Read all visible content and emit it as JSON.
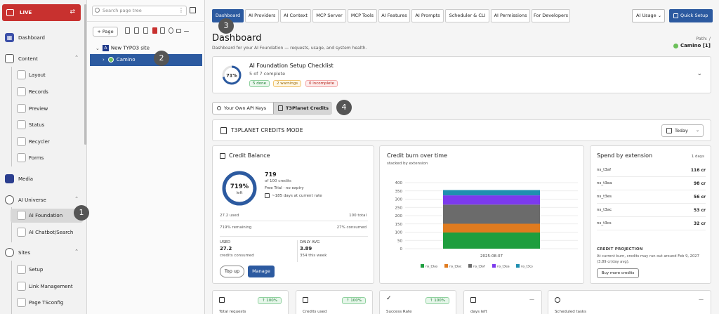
{
  "live": {
    "label": "LIVE"
  },
  "menu": {
    "dashboard": "Dashboard",
    "content": "Content",
    "layout": "Layout",
    "records": "Records",
    "preview": "Preview",
    "status": "Status",
    "recycler": "Recycler",
    "forms": "Forms",
    "media": "Media",
    "ai_universe": "AI Universe",
    "ai_foundation": "AI Foundation",
    "ai_chatbot": "AI Chatbot/Search",
    "sites": "Sites",
    "setup": "Setup",
    "link_management": "Link Management",
    "page_tsconfig": "Page TSconfig"
  },
  "tree": {
    "search_placeholder": "Search page tree",
    "new_page": "+ Page",
    "root": "New TYPO3 site",
    "root_logo": "A",
    "node": "Camino"
  },
  "tabs": [
    "Dashboard",
    "AI Providers",
    "AI Context",
    "MCP Server",
    "MCP Tools",
    "AI Features",
    "AI Prompts",
    "Scheduler & CLI",
    "AI Permissions",
    "For Developers"
  ],
  "header": {
    "ai_usage": "AI Usage",
    "quick_setup": "Quick Setup",
    "title": "Dashboard",
    "subtitle": "Dashboard for your AI Foundation — requests, usage, and system health.",
    "path_label": "Path: /",
    "path_value": "Camino [1]"
  },
  "checklist": {
    "percent": "71%",
    "progress": 0.71,
    "title": "AI Foundation Setup Checklist",
    "subtitle": "5 of 7 complete",
    "done": "5 done",
    "warnings": "2 warnings",
    "incomplete": "0 incomplete"
  },
  "mode_toggle": {
    "own": "Your Own API Keys",
    "t3": "T3Planet Credits"
  },
  "credits_mode": {
    "title": "T3PLANET CREDITS MODE",
    "range": "Today"
  },
  "balance": {
    "title": "Credit Balance",
    "ring_value": "719%",
    "ring_label": "left",
    "ring_fill": 1.0,
    "value": "719",
    "of": "of 100 credits",
    "plan": "Free Trial · no expiry",
    "days": "~185 days at current rate",
    "used_line": "27.2 used",
    "total_line": "100 total",
    "remaining_line": "719% remaining",
    "consumed_line": "27% consumed",
    "used_label": "USED",
    "used_value": "27.2",
    "used_sub": "credits consumed",
    "avg_label": "DAILY AVG",
    "avg_value": "3.89",
    "avg_sub": "354 this week",
    "top_up": "Top up",
    "manage": "Manage"
  },
  "burn": {
    "title": "Credit burn over time",
    "subtitle": "stacked by extension"
  },
  "chart_data": {
    "type": "bar",
    "stacked": true,
    "categories": [
      "2025-08-07"
    ],
    "series": [
      {
        "name": "ns_t3as",
        "values": [
          98
        ],
        "color": "#1e9e3e"
      },
      {
        "name": "ns_t3ac",
        "values": [
          53
        ],
        "color": "#e07b1f"
      },
      {
        "name": "ns_t3af",
        "values": [
          116
        ],
        "color": "#6b6b6b"
      },
      {
        "name": "ns_t3ea",
        "values": [
          56
        ],
        "color": "#7c3aed"
      },
      {
        "name": "ns_t3cs",
        "values": [
          32
        ],
        "color": "#1f8fb0"
      }
    ],
    "ylim": [
      0,
      400
    ],
    "yticks": [
      "0",
      "50",
      "100",
      "150",
      "200",
      "250",
      "300",
      "350",
      "400"
    ],
    "grid": true,
    "legend": "bottom"
  },
  "spend": {
    "title": "Spend by extension",
    "range": "1 days",
    "rows": [
      {
        "name": "ns_t3af",
        "value": "116 cr"
      },
      {
        "name": "ns_t3ea",
        "value": "98 cr"
      },
      {
        "name": "ns_t3es",
        "value": "56 cr"
      },
      {
        "name": "ns_t3ac",
        "value": "53 cr"
      },
      {
        "name": "ns_t3cs",
        "value": "32 cr"
      }
    ],
    "projection_label": "CREDIT PROJECTION",
    "projection_text": "At current burn, credits may run out around Feb 9, 2027 (3.89 cr/day avg).",
    "buy_more": "Buy more credits"
  },
  "stats": [
    {
      "label": "Total requests",
      "badge": "↑ 100%"
    },
    {
      "label": "Credits used",
      "badge": "↑ 100%"
    },
    {
      "label": "Success Rate",
      "badge": "↑ 100%"
    },
    {
      "label": "days left",
      "badge": "—"
    },
    {
      "label": "Scheduled tasks",
      "badge": "—"
    }
  ],
  "markers": [
    "1",
    "2",
    "3",
    "4"
  ],
  "colors": {
    "accent": "#2c5aa0",
    "live": "#c8312f"
  }
}
